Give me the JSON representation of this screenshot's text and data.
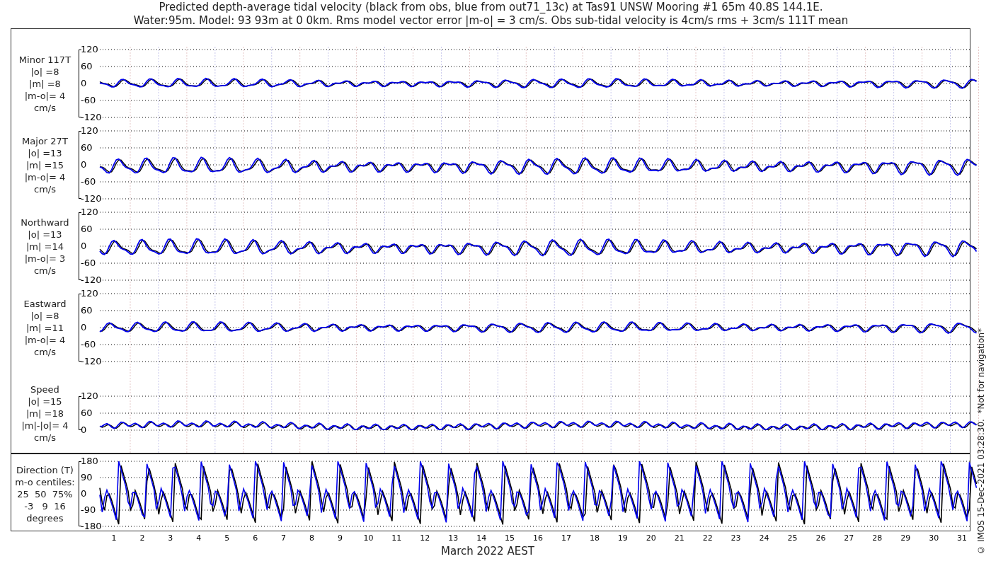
{
  "title_lines": [
    "Predicted depth-average tidal velocity (black from obs, blue from out71_13c) at Tas91 UNSW Mooring #1 65m 40.8S 144.1E.",
    "Water:95m. Model: 93 93m at 0 0km. Rms model vector error |m-o| = 3 cm/s. Obs sub-tidal velocity is 4cm/s rms + 3cm/s 111T mean"
  ],
  "panels": [
    {
      "kind": "velocity",
      "label_lines": [
        "Minor 117T",
        "|o| =8",
        "|m| =8",
        "|m-o|= 4",
        "cm/s"
      ],
      "yticks": [
        "120",
        "60",
        "0",
        "-60",
        "-120"
      ]
    },
    {
      "kind": "velocity",
      "label_lines": [
        "Major 27T",
        "|o| =13",
        "|m| =15",
        "|m-o|= 4",
        "cm/s"
      ],
      "yticks": [
        "120",
        "60",
        "0",
        "-60",
        "-120"
      ]
    },
    {
      "kind": "velocity",
      "label_lines": [
        "Northward",
        "|o| =13",
        "|m| =14",
        "|m-o|= 3",
        "cm/s"
      ],
      "yticks": [
        "120",
        "60",
        "0",
        "-60",
        "-120"
      ]
    },
    {
      "kind": "velocity",
      "label_lines": [
        "Eastward",
        "|o| =8",
        "|m| =11",
        "|m-o|= 4",
        "cm/s"
      ],
      "yticks": [
        "120",
        "60",
        "0",
        "-60",
        "-120"
      ]
    },
    {
      "kind": "speed",
      "label_lines": [
        "Speed",
        "|o| =15",
        "|m| =18",
        "|m|-|o|= 4",
        "cm/s"
      ],
      "yticks": [
        "120",
        "60",
        "0"
      ]
    },
    {
      "kind": "direction",
      "label_lines": [
        "Direction (T)",
        "m-o centiles:",
        "25  50  75%",
        "-3   9  16",
        "degrees"
      ],
      "yticks": [
        "180",
        "90",
        "0",
        "-90",
        "-180"
      ]
    }
  ],
  "xticks": [
    "1",
    "2",
    "3",
    "4",
    "5",
    "6",
    "7",
    "8",
    "9",
    "10",
    "11",
    "12",
    "13",
    "14",
    "15",
    "16",
    "17",
    "18",
    "19",
    "20",
    "21",
    "22",
    "23",
    "24",
    "25",
    "26",
    "27",
    "28",
    "29",
    "30",
    "31"
  ],
  "xlabel": "March 2022 AEST",
  "credit": "© IMOS 15-Dec-2021 03:28:30.  *Not for navigation*"
}
